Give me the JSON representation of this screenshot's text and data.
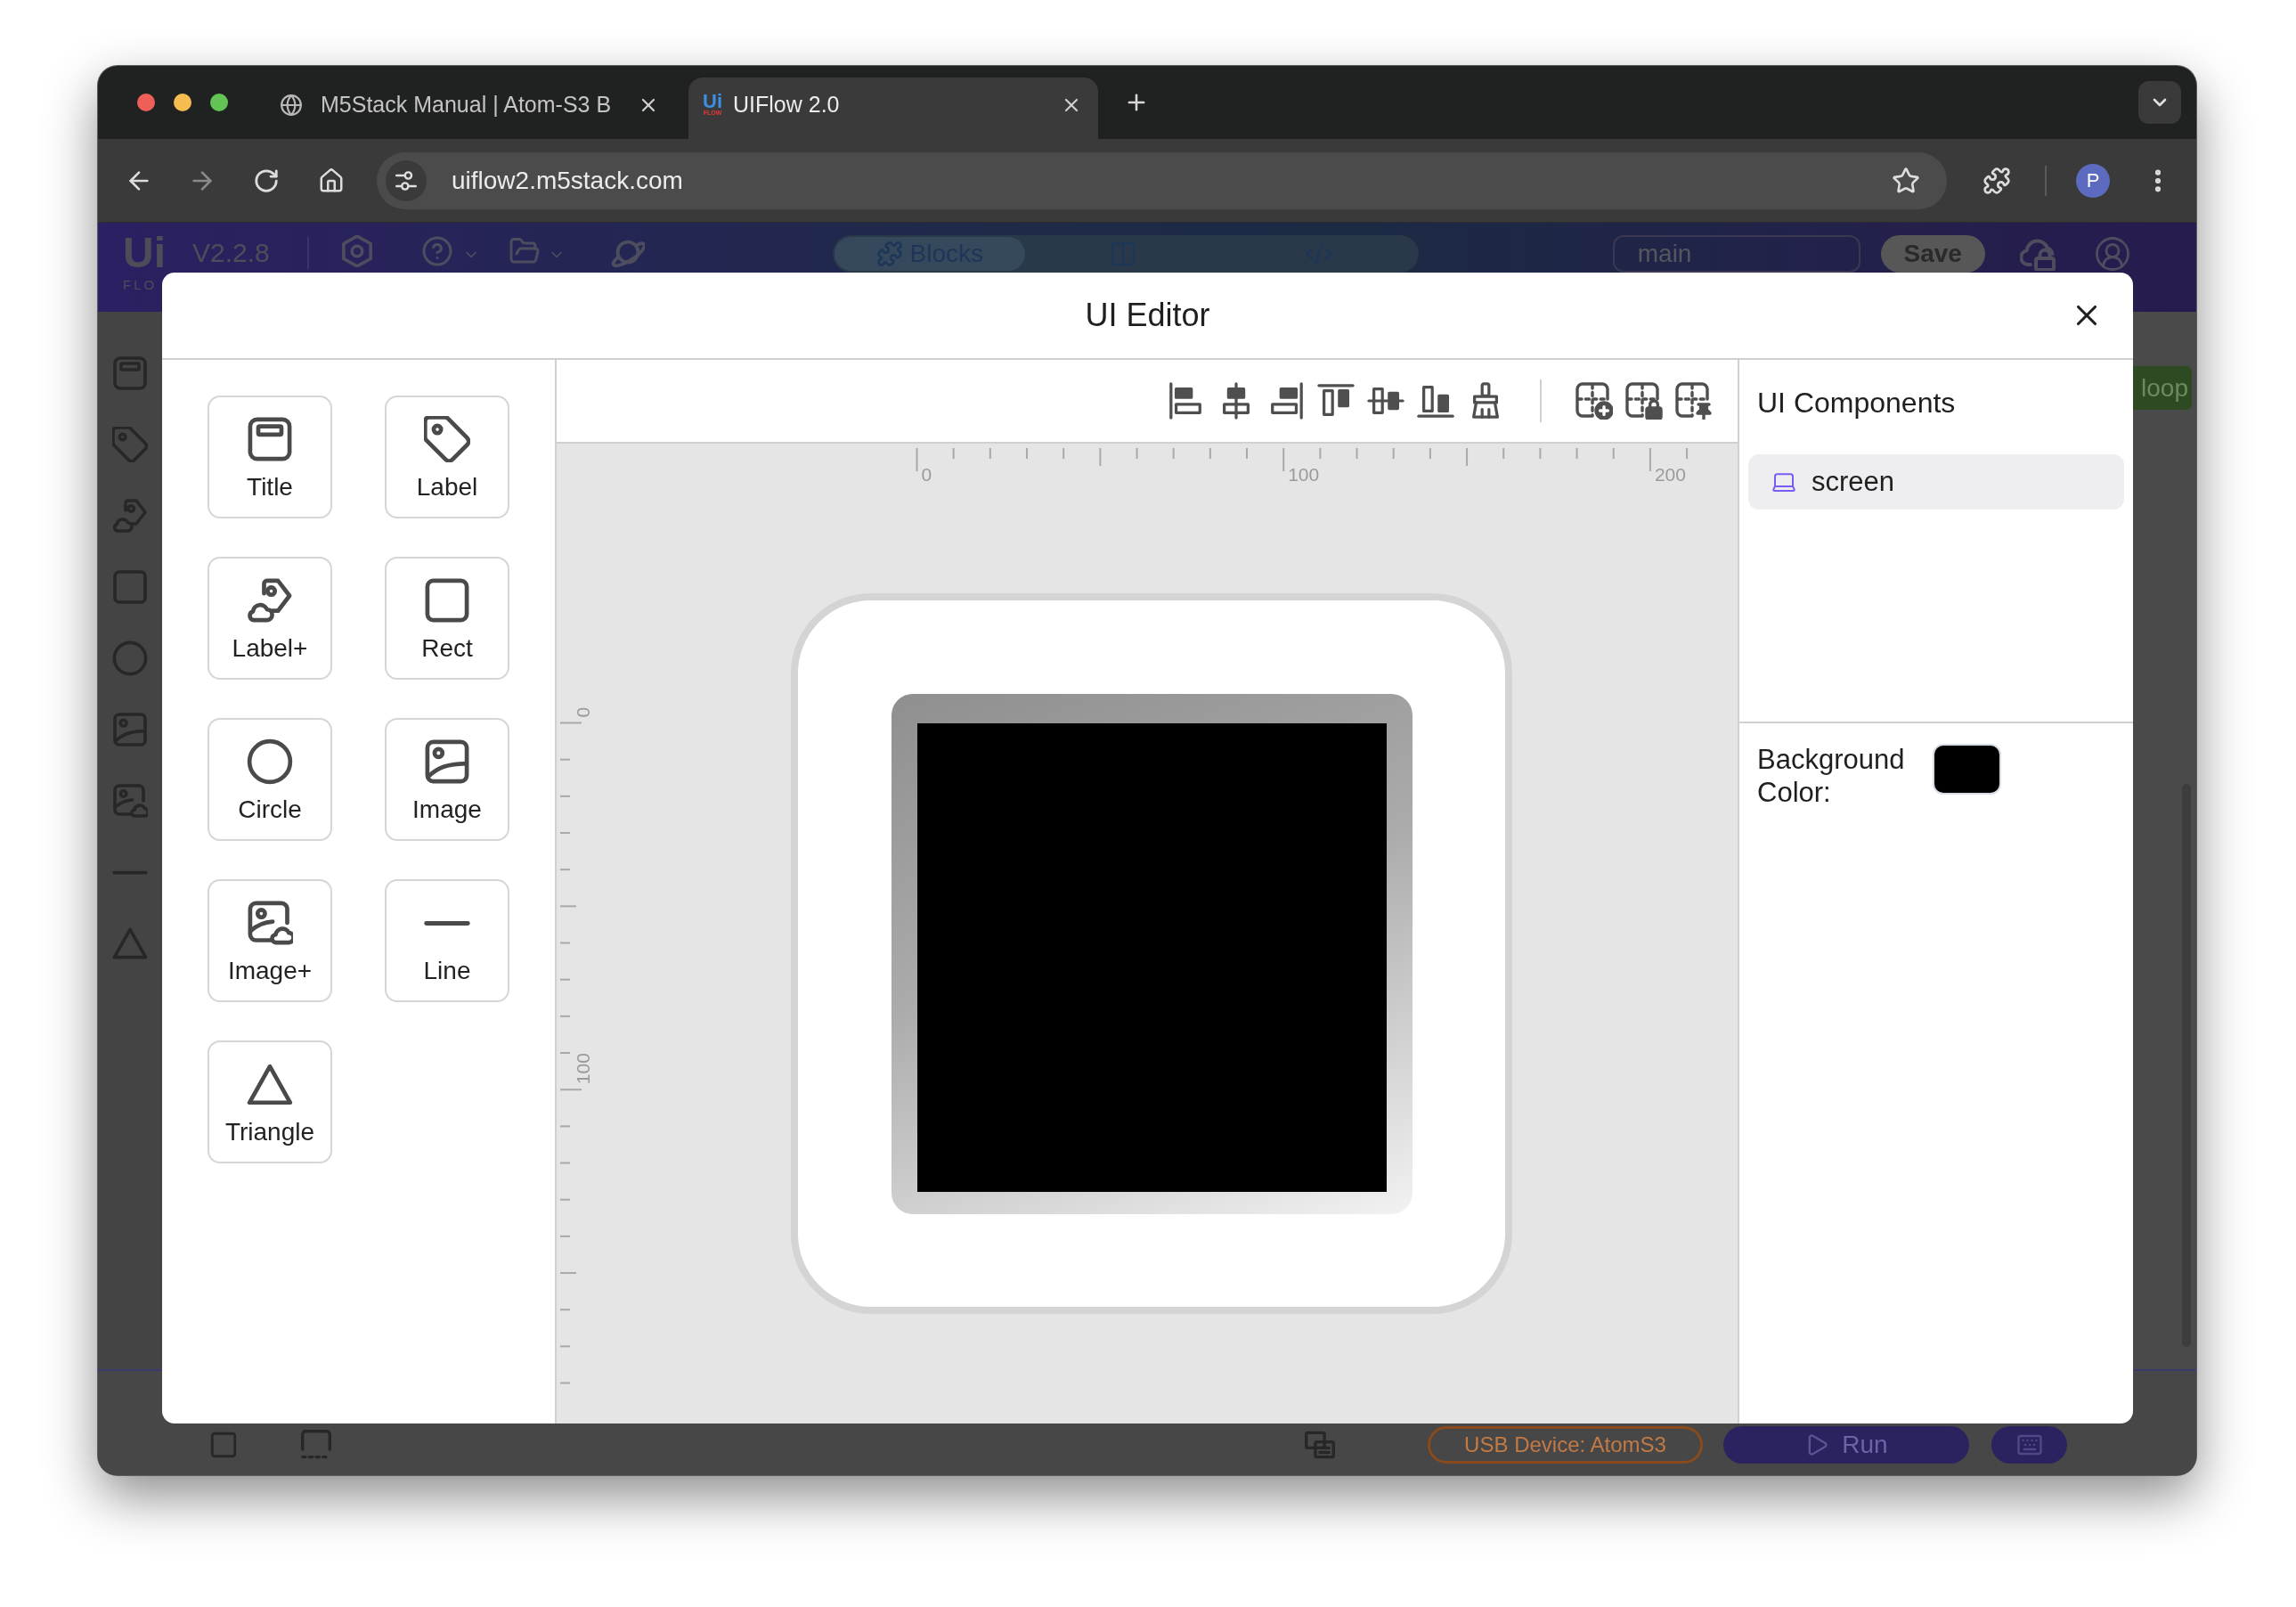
{
  "browser": {
    "tabs": [
      {
        "kind": "web",
        "title": "M5Stack Manual | Atom-S3 B",
        "selected": false
      },
      {
        "kind": "app",
        "logo": "Ui",
        "logo_caption": "FLOW",
        "title": "UIFlow 2.0",
        "selected": true
      }
    ],
    "url": "uiflow2.m5stack.com",
    "profile": "P"
  },
  "app": {
    "logo": "Ui",
    "logo_caption": "FLO",
    "version": "V2.2.8",
    "views": [
      {
        "kind": "blocks",
        "label": "Blocks",
        "selected": true
      },
      {
        "kind": "split",
        "selected": false
      },
      {
        "kind": "code",
        "selected": false
      }
    ],
    "file_name": "main",
    "save": "Save",
    "block": "loop",
    "device": "USB Device: AtomS3",
    "run": "Run"
  },
  "dialog": {
    "title": "UI Editor",
    "palette": [
      {
        "kind": "title",
        "label": "Title"
      },
      {
        "kind": "label",
        "label": "Label"
      },
      {
        "kind": "label_plus",
        "label": "Label+"
      },
      {
        "kind": "rect",
        "label": "Rect"
      },
      {
        "kind": "circle",
        "label": "Circle"
      },
      {
        "kind": "image",
        "label": "Image"
      },
      {
        "kind": "image_plus",
        "label": "Image+"
      },
      {
        "kind": "line",
        "label": "Line"
      },
      {
        "kind": "triangle",
        "label": "Triangle"
      }
    ],
    "rulers": {
      "x_labels": [
        "0",
        "100",
        "200"
      ],
      "y_labels": [
        "0",
        "100"
      ]
    },
    "components_title": "UI Components",
    "components": [
      {
        "label": "screen",
        "selected": true
      }
    ],
    "background_color": {
      "label": "Background Color:",
      "color": "#000000"
    }
  }
}
